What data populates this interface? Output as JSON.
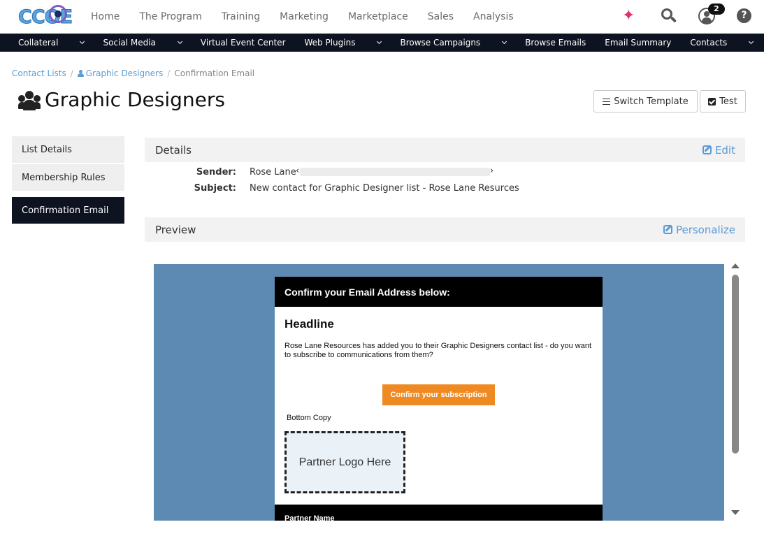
{
  "logo": {
    "text": "CCOE"
  },
  "topnav": {
    "items": [
      "Home",
      "The Program",
      "Training",
      "Marketing",
      "Marketplace",
      "Sales",
      "Analysis"
    ],
    "notification_count": "2",
    "help_label": "?"
  },
  "subnav": {
    "items": [
      "Collateral",
      "Social Media",
      "Virtual Event Center",
      "Web Plugins",
      "Browse Campaigns",
      "Browse Emails",
      "Email Summary",
      "Contacts"
    ]
  },
  "breadcrumb": {
    "item1": "Contact Lists",
    "item2": "Graphic Designers",
    "current": "Confirmation Email",
    "separator": "/"
  },
  "page": {
    "title": "Graphic Designers",
    "switch_template_label": "Switch Template",
    "test_label": "Test"
  },
  "sidebar": {
    "items": [
      {
        "label": "List Details"
      },
      {
        "label": "Membership Rules"
      },
      {
        "label": "Confirmation Email"
      }
    ]
  },
  "details": {
    "heading": "Details",
    "edit_label": "Edit",
    "sender_label": "Sender:",
    "sender_value": "Rose Lane",
    "sender_open": "‹",
    "sender_close": "›",
    "subject_label": "Subject:",
    "subject_value": "New contact for Graphic Designer list - Rose Lane Resurces"
  },
  "preview": {
    "heading": "Preview",
    "personalize_label": "Personalize"
  },
  "email": {
    "header": "Confirm your Email Address below:",
    "headline": "Headline",
    "body": "Rose Lane Resources has added you to their Graphic Designers contact list - do you want to subscribe to communications from them?",
    "button": "Confirm your subscription",
    "bottom_copy": "Bottom Copy",
    "partner_logo": "Partner Logo Here",
    "partner_name": "Partner Name"
  },
  "colors": {
    "accent_blue": "#5b9bd5",
    "dark_nav": "#0d1320",
    "cta_orange": "#ef8a23",
    "preview_bg": "#5d8ab3"
  }
}
